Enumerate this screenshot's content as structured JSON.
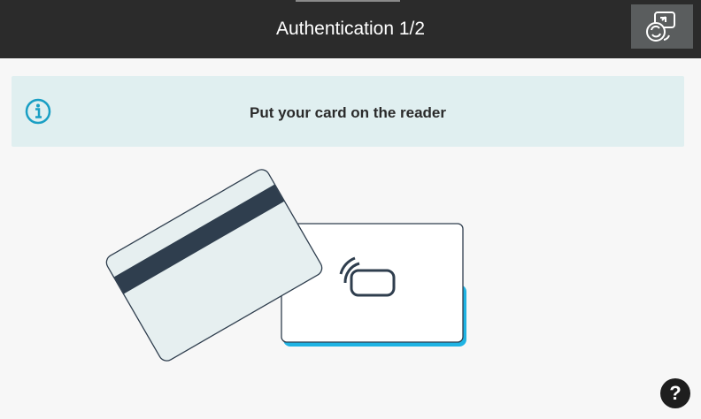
{
  "header": {
    "title": "Authentication 1/2",
    "switch_icon": "card-switch-icon",
    "background_color": "#2b2b2b"
  },
  "banner": {
    "icon": "info-icon",
    "message": "Put your card on the reader",
    "background_color": "#e0eff0",
    "icon_color": "#1a9fc4"
  },
  "illustration": {
    "swipe_card_icon": "magnetic-stripe-card",
    "contactless_card_icon": "contactless-card",
    "accent_color": "#1fb3e3"
  },
  "help": {
    "label": "?"
  }
}
